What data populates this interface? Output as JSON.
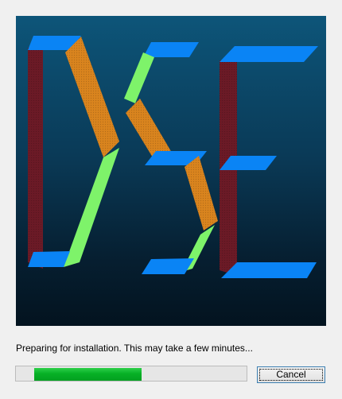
{
  "splash": {
    "logo_name": "dse-logo",
    "colors": {
      "background_top": "#0d5579",
      "background_bottom": "#03131f",
      "bar_red": "#6b1a26",
      "bar_orange": "#d9841e",
      "bar_green": "#7ef36a",
      "bar_blue": "#0a84f5"
    }
  },
  "status": {
    "message": "Preparing for installation. This may take a few minutes..."
  },
  "progress": {
    "fraction": 0.43,
    "color": "#06b025"
  },
  "buttons": {
    "cancel_label": "Cancel"
  }
}
